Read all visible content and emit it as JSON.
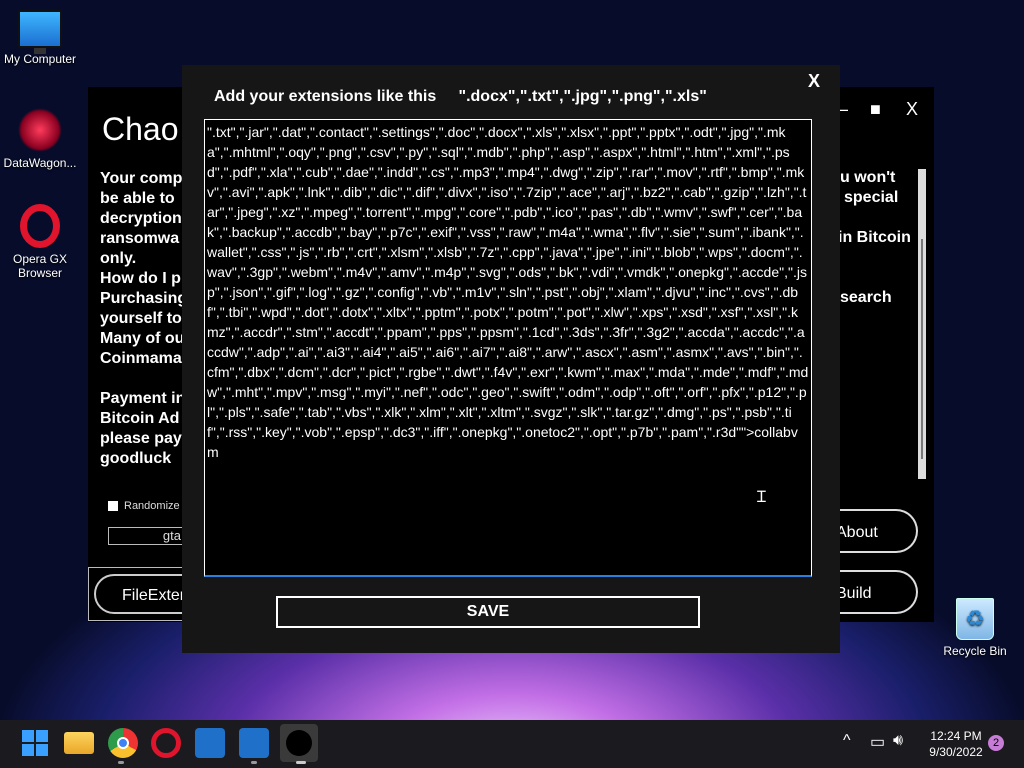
{
  "desktop": {
    "icons": [
      {
        "label": "My Computer"
      },
      {
        "label": "DataWagon..."
      },
      {
        "label": "Opera GX Browser"
      },
      {
        "label": "Recycle Bin"
      }
    ]
  },
  "background_window": {
    "title_partial": "Chao",
    "text_left": [
      "Your comp",
      "be able to",
      "decryption",
      "ransomwa",
      "only.",
      "How do I p",
      "Purchasing",
      "yourself  to",
      "Many of ou",
      "Coinmama"
    ],
    "text_left2": [
      "Payment in",
      "Bitcoin Ad",
      "please pay",
      "goodluck"
    ],
    "text_right": [
      "u won't",
      "special",
      "in Bitcoin",
      "search"
    ],
    "randomize_label": "Randomize",
    "name_field_value": "gta",
    "file_ext_button": "FileExten",
    "about_button": "About",
    "build_button": "Build",
    "minimize_glyph": "–",
    "maximize_glyph": "■",
    "close_glyph": "X"
  },
  "dialog": {
    "close_glyph": "X",
    "header": "Add your extensions like this     \".docx\",\".txt\",\".jpg\",\".png\",\".xls\"",
    "extensions_text": "\".txt\",\".jar\",\".dat\",\".contact\",\".settings\",\".doc\",\".docx\",\".xls\",\".xlsx\",\".ppt\",\".pptx\",\".odt\",\".jpg\",\".mka\",\".mhtml\",\".oqy\",\".png\",\".csv\",\".py\",\".sql\",\".mdb\",\".php\",\".asp\",\".aspx\",\".html\",\".htm\",\".xml\",\".psd\",\".pdf\",\".xla\",\".cub\",\".dae\",\".indd\",\".cs\",\".mp3\",\".mp4\",\".dwg\",\".zip\",\".rar\",\".mov\",\".rtf\",\".bmp\",\".mkv\",\".avi\",\".apk\",\".lnk\",\".dib\",\".dic\",\".dif\",\".divx\",\".iso\",\".7zip\",\".ace\",\".arj\",\".bz2\",\".cab\",\".gzip\",\".lzh\",\".tar\",\".jpeg\",\".xz\",\".mpeg\",\".torrent\",\".mpg\",\".core\",\".pdb\",\".ico\",\".pas\",\".db\",\".wmv\",\".swf\",\".cer\",\".bak\",\".backup\",\".accdb\",\".bay\",\".p7c\",\".exif\",\".vss\",\".raw\",\".m4a\",\".wma\",\".flv\",\".sie\",\".sum\",\".ibank\",\".wallet\",\".css\",\".js\",\".rb\",\".crt\",\".xlsm\",\".xlsb\",\".7z\",\".cpp\",\".java\",\".jpe\",\".ini\",\".blob\",\".wps\",\".docm\",\".wav\",\".3gp\",\".webm\",\".m4v\",\".amv\",\".m4p\",\".svg\",\".ods\",\".bk\",\".vdi\",\".vmdk\",\".onepkg\",\".accde\",\".jsp\",\".json\",\".gif\",\".log\",\".gz\",\".config\",\".vb\",\".m1v\",\".sln\",\".pst\",\".obj\",\".xlam\",\".djvu\",\".inc\",\".cvs\",\".dbf\",\".tbi\",\".wpd\",\".dot\",\".dotx\",\".xltx\",\".pptm\",\".potx\",\".potm\",\".pot\",\".xlw\",\".xps\",\".xsd\",\".xsf\",\".xsl\",\".kmz\",\".accdr\",\".stm\",\".accdt\",\".ppam\",\".pps\",\".ppsm\",\".1cd\",\".3ds\",\".3fr\",\".3g2\",\".accda\",\".accdc\",\".accdw\",\".adp\",\".ai\",\".ai3\",\".ai4\",\".ai5\",\".ai6\",\".ai7\",\".ai8\",\".arw\",\".ascx\",\".asm\",\".asmx\",\".avs\",\".bin\",\".cfm\",\".dbx\",\".dcm\",\".dcr\",\".pict\",\".rgbe\",\".dwt\",\".f4v\",\".exr\",\".kwm\",\".max\",\".mda\",\".mde\",\".mdf\",\".mdw\",\".mht\",\".mpv\",\".msg\",\".myi\",\".nef\",\".odc\",\".geo\",\".swift\",\".odm\",\".odp\",\".oft\",\".orf\",\".pfx\",\".p12\",\".pl\",\".pls\",\".safe\",\".tab\",\".vbs\",\".xlk\",\".xlm\",\".xlt\",\".xltm\",\".svgz\",\".slk\",\".tar.gz\",\".dmg\",\".ps\",\".psb\",\".tif\",\".rss\",\".key\",\".vob\",\".epsp\",\".dc3\",\".iff\",\".onepkg\",\".onetoc2\",\".opt\",\".p7b\",\".pam\",\".r3d\"\">collabvm",
    "save_button": "SAVE"
  },
  "taskbar": {
    "clock_time": "12:24 PM",
    "clock_date": "9/30/2022",
    "notification_count": "2",
    "chevron": "^"
  }
}
